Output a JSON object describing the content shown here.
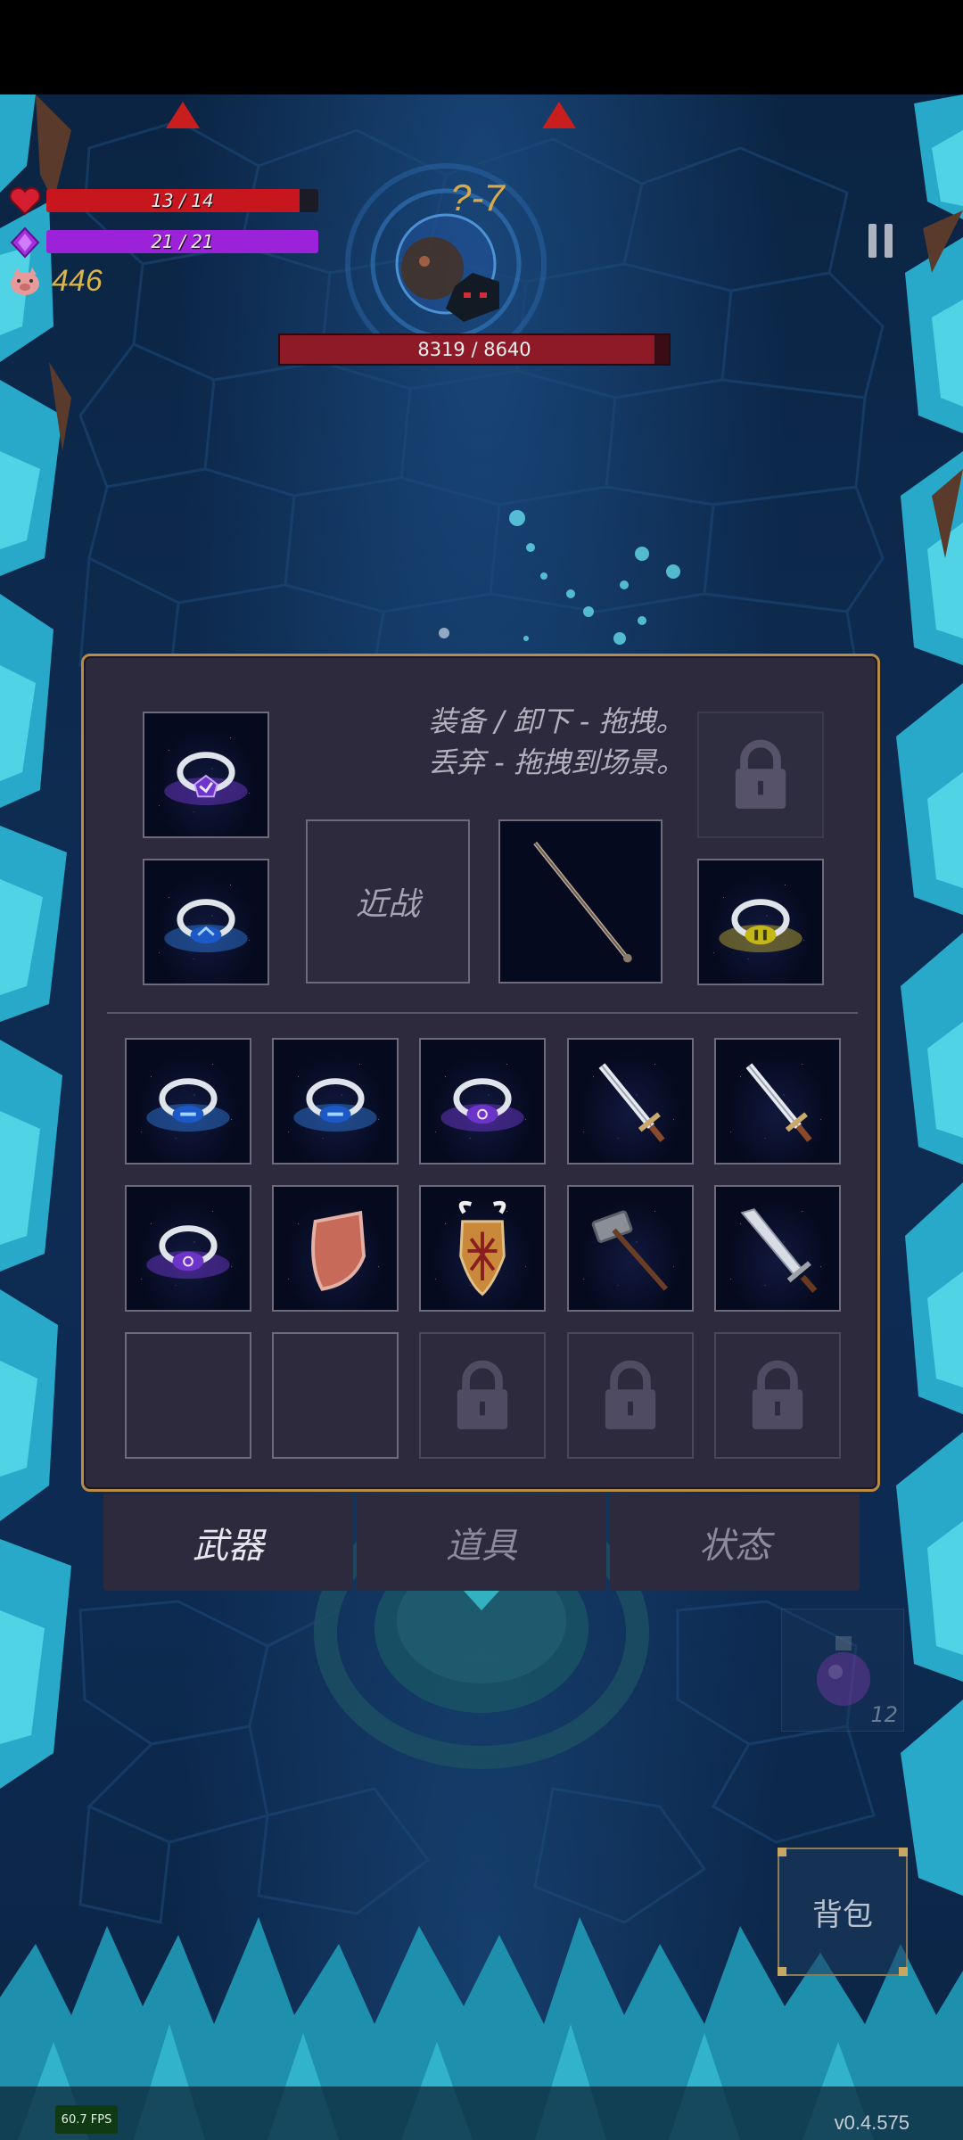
{
  "hud": {
    "hp_text": "13 / 14",
    "hp_fraction": 0.93,
    "mp_text": "21 / 21",
    "mp_fraction": 1.0,
    "gold": "446",
    "hp_color": "#c8161e",
    "mp_color": "#9b22d8"
  },
  "stage": {
    "label": "?-7"
  },
  "boss": {
    "hp_text": "8319 / 8640",
    "hp_fraction": 0.963
  },
  "inventory": {
    "hint_line1": "装备 / 卸下 - 拖拽。",
    "hint_line2": "丢弃 - 拖拽到场景。",
    "melee_label": "近战",
    "equipped_slots": [
      {
        "item": "purple-ring-icon"
      },
      {
        "item": "blue-ring-icon"
      },
      {
        "item": "locked-icon"
      },
      {
        "item": "gold-ring-icon"
      },
      {
        "item": "staff-icon"
      }
    ],
    "bag_slots": [
      "blue-ring-icon",
      "blue-ring-icon",
      "purple-ring-icon",
      "sword-icon",
      "sword-icon",
      "purple-ring-icon",
      "shield-icon",
      "winged-shield-icon",
      "hammer-icon",
      "greatsword-icon",
      "empty",
      "empty",
      "locked-icon",
      "locked-icon",
      "locked-icon"
    ]
  },
  "tabs": [
    {
      "label": "武器",
      "active": true
    },
    {
      "label": "道具",
      "active": false
    },
    {
      "label": "状态",
      "active": false
    }
  ],
  "backpack": {
    "label": "背包"
  },
  "potion": {
    "count": "12"
  },
  "fps": "60.7 FPS",
  "version": "v0.4.575",
  "colors": {
    "panel_bg": "#2c2a3c",
    "panel_border": "#b88c46",
    "accent_gold": "#d6a94a"
  }
}
